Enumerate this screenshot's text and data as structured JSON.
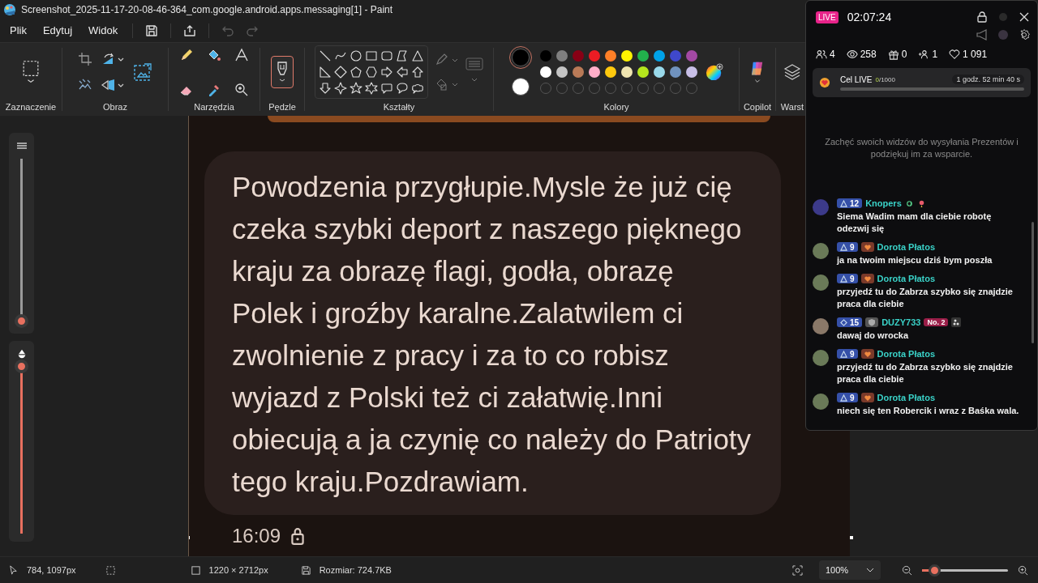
{
  "window": {
    "title": "Screenshot_2025-11-17-20-08-46-364_com.google.android.apps.messaging[1] - Paint"
  },
  "menu": [
    {
      "label": "Plik"
    },
    {
      "label": "Edytuj"
    },
    {
      "label": "Widok"
    }
  ],
  "quick_actions": [
    {
      "kind": "save",
      "disabled": false
    },
    {
      "kind": "share",
      "disabled": false
    },
    {
      "kind": "undo",
      "disabled": true
    },
    {
      "kind": "redo",
      "disabled": true
    }
  ],
  "ribbon": {
    "groups": [
      "Zaznaczenie",
      "Obraz",
      "Narzędzia",
      "Pędzle",
      "Kształty",
      "Kolory",
      "Copilot",
      "Warst"
    ],
    "brush": {
      "selected": true
    },
    "primary": {
      "color": "#000000",
      "selected": true
    },
    "secondary": {
      "color": "#ffffff",
      "selected": false
    },
    "palette": [
      {
        "color": "#000000"
      },
      {
        "color": "#7f7f7f"
      },
      {
        "color": "#880015"
      },
      {
        "color": "#ed1c24"
      },
      {
        "color": "#ff7f27"
      },
      {
        "color": "#fff200"
      },
      {
        "color": "#22b14c"
      },
      {
        "color": "#00a2e8"
      },
      {
        "color": "#3f48cc"
      },
      {
        "color": "#a349a4"
      },
      {
        "color": "#ffffff"
      },
      {
        "color": "#c3c3c3"
      },
      {
        "color": "#b97a57"
      },
      {
        "color": "#ffaec9"
      },
      {
        "color": "#ffc90e"
      },
      {
        "color": "#efe4b0"
      },
      {
        "color": "#b5e61d"
      },
      {
        "color": "#99d9ea"
      },
      {
        "color": "#7092be"
      },
      {
        "color": "#c8bfe7"
      }
    ]
  },
  "size_slider": {
    "level": 0.02
  },
  "opacity_slider": {
    "level": 1
  },
  "canvas": {
    "message": {
      "text": "Powodzenia przygłupie.Mysle że już cię czeka szybki deport z naszego pięknego kraju za obrazę flagi, godła, obrazę Polek i groźby karalne.Zalatwilem ci zwolnienie z pracy i za to co robisz wyjazd z Polski też ci załatwię.Inni obiecują a ja czynię co należy do Patrioty tego kraju.Pozdrawiam.",
      "time": "16:09",
      "locked": true
    }
  },
  "status_bar": {
    "cursor": "784, 1097px",
    "dimensions": "1220 × 2712px",
    "file_size": "Rozmiar: 724.7KB",
    "zoom": "100%",
    "zoom_slider": {
      "level": 0.15
    }
  },
  "live": {
    "badge": "LIVE",
    "timer": "02:07:24",
    "stats": [
      {
        "kind": "viewers",
        "value": "4"
      },
      {
        "kind": "views",
        "value": "258"
      },
      {
        "kind": "gifts",
        "value": "0"
      },
      {
        "kind": "followers",
        "value": "1"
      },
      {
        "kind": "likes",
        "value": "1 091"
      }
    ],
    "goal": {
      "title": "Cel LIVE",
      "current": "0",
      "total": "/1000",
      "remaining": "1 godz. 52 min 40 s",
      "level": 0
    },
    "prompt": "Zachęć swoich widzów do wysyłania Prezentów i podziękuj im za wsparcie.",
    "chat": [
      {
        "kind": "emoji",
        "name": "Knopers",
        "level_badge": {
          "kind": "triangle",
          "number": "12"
        },
        "text": "Siema Wadim mam dla ciebie robotę odezwij się"
      },
      {
        "kind": "fan",
        "name": "Dorota Płatos",
        "level_badge": {
          "kind": "triangle",
          "number": "9"
        },
        "text": "ja na twoim miejscu dziś bym poszła"
      },
      {
        "kind": "fan",
        "name": "Dorota Płatos",
        "level_badge": {
          "kind": "triangle",
          "number": "9"
        },
        "text": "przyjedź tu do Zabrza szybko się znajdzie praca dla ciebie"
      },
      {
        "kind": "ranked",
        "name": "DUZY733",
        "level_badge": {
          "kind": "diamond",
          "number": "15"
        },
        "rank": "No. 2",
        "text": "dawaj do wrocka"
      },
      {
        "kind": "fan",
        "name": "Dorota Płatos",
        "level_badge": {
          "kind": "triangle",
          "number": "9"
        },
        "text": "przyjedź tu do Zabrza szybko się znajdzie praca dla ciebie"
      },
      {
        "kind": "fan",
        "name": "Dorota Płatos",
        "level_badge": {
          "kind": "triangle",
          "number": "9"
        },
        "text": "niech się ten Robercik i wraz z Baśka wala."
      }
    ]
  }
}
